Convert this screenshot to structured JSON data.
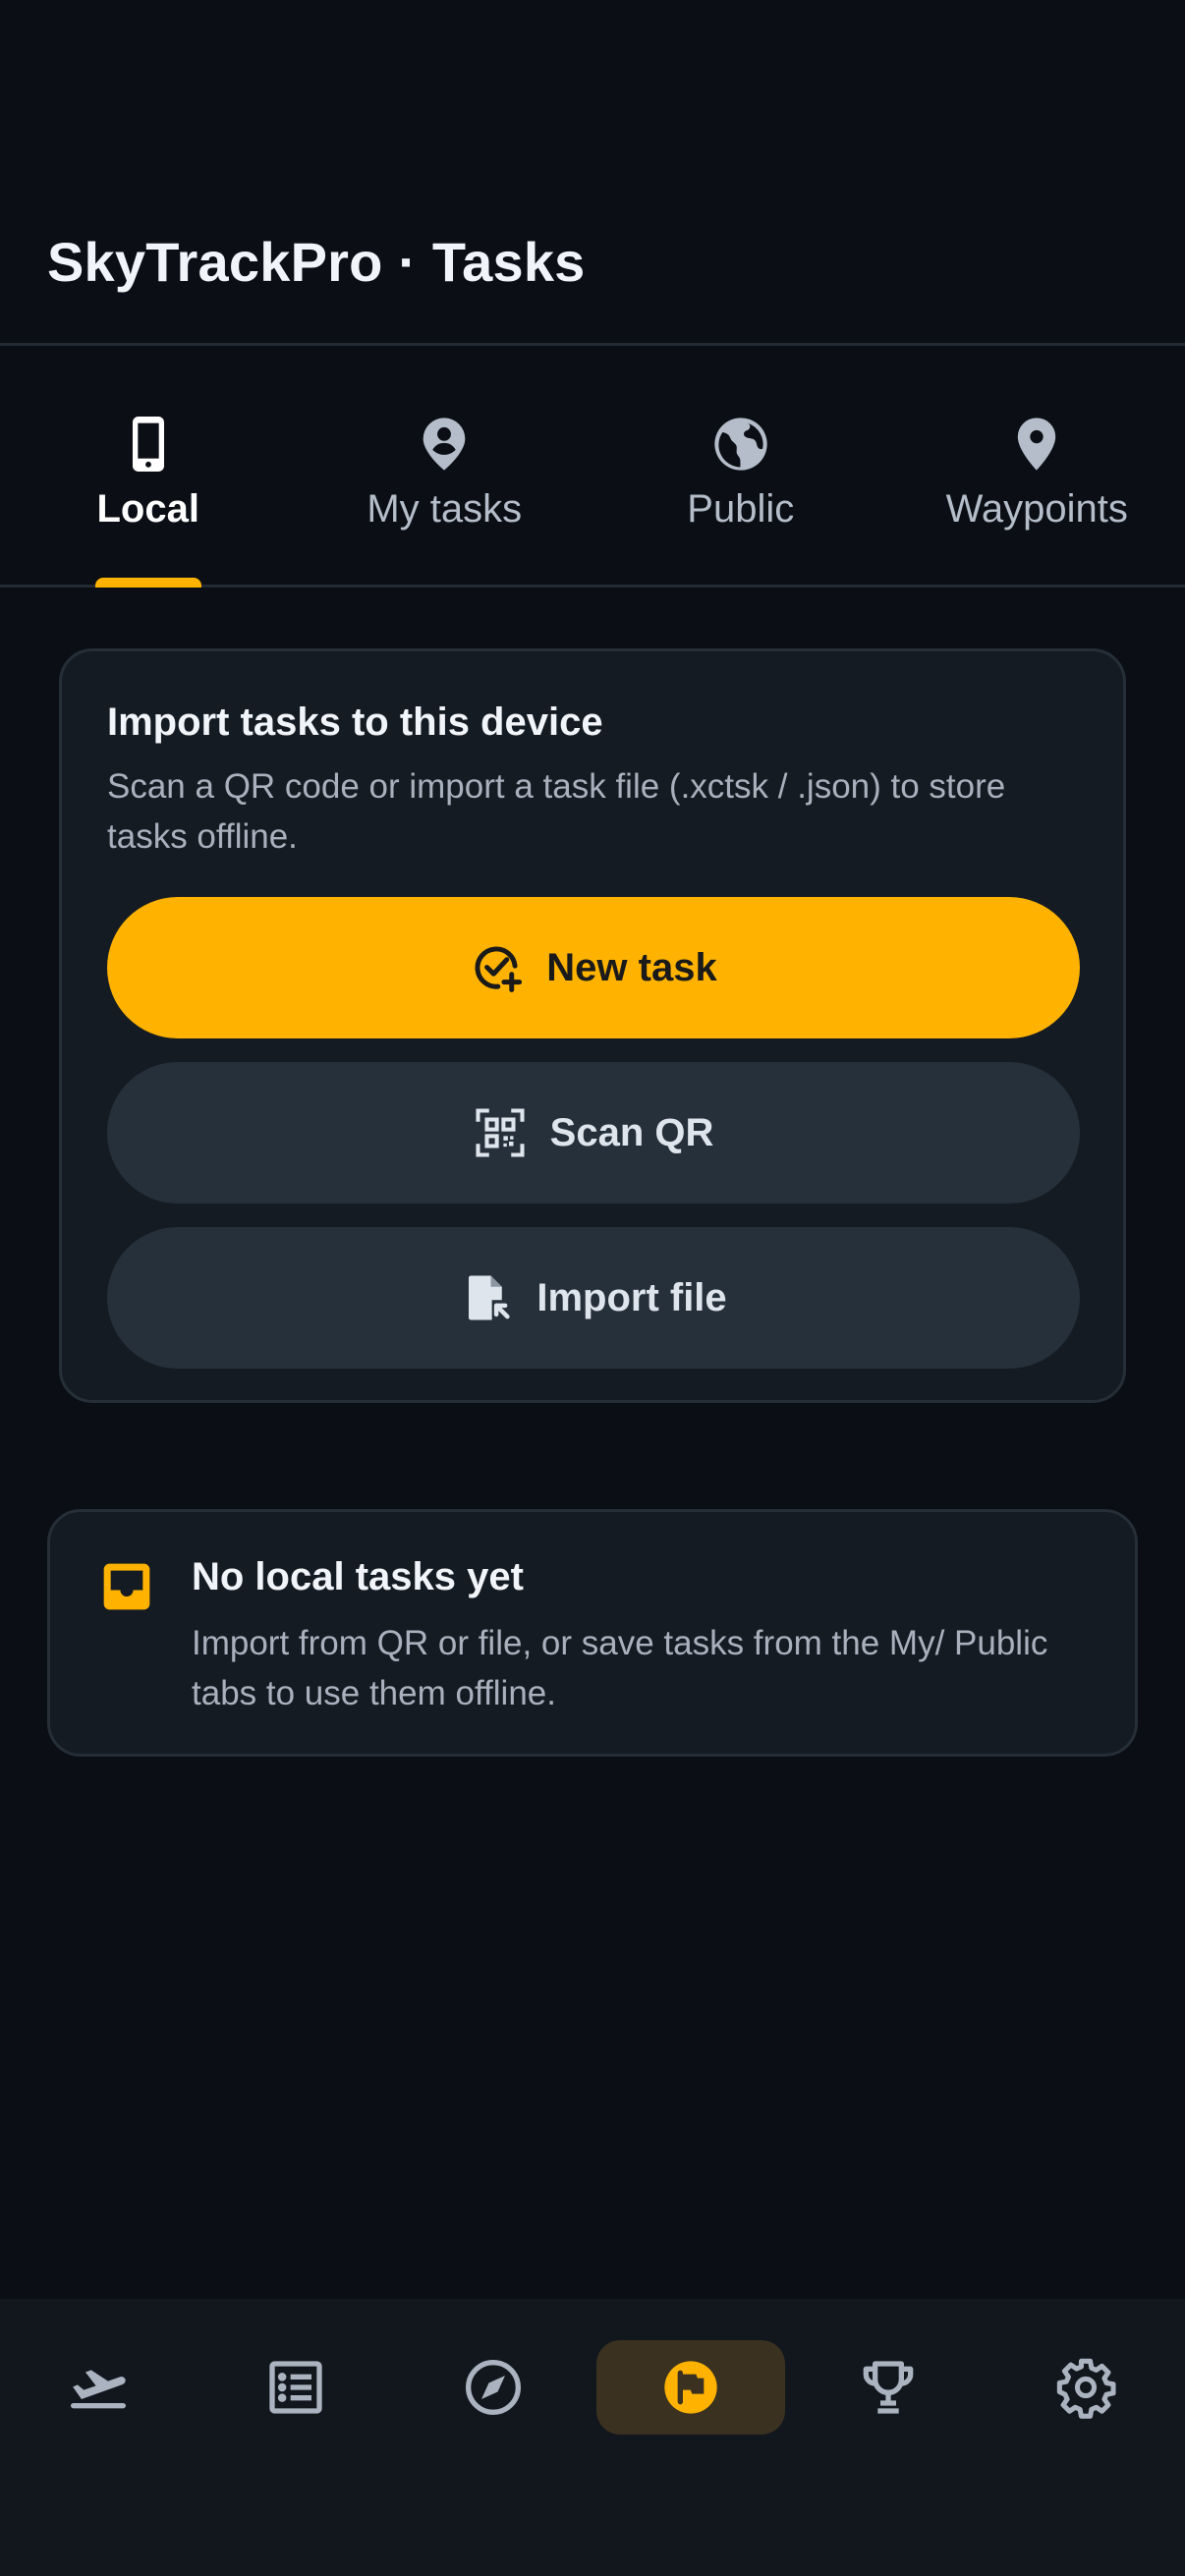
{
  "app": {
    "title": "SkyTrackPro · Tasks"
  },
  "tabs": [
    {
      "label": "Local",
      "icon": "phone-icon",
      "active": true
    },
    {
      "label": "My tasks",
      "icon": "account-pin-icon",
      "active": false
    },
    {
      "label": "Public",
      "icon": "globe-icon",
      "active": false
    },
    {
      "label": "Waypoints",
      "icon": "map-pin-icon",
      "active": false
    }
  ],
  "import_card": {
    "title": "Import tasks to this device",
    "description": "Scan a QR code or import a task file (.xctsk / .json) to store tasks offline.",
    "new_task_label": "New task",
    "scan_qr_label": "Scan QR",
    "import_file_label": "Import file"
  },
  "empty_state": {
    "title": "No local tasks yet",
    "description": "Import from QR or file, or save tasks from the My/ Public tabs to use them offline."
  },
  "bottom_nav": [
    {
      "icon": "takeoff-icon",
      "active": false
    },
    {
      "icon": "list-icon",
      "active": false
    },
    {
      "icon": "compass-icon",
      "active": false
    },
    {
      "icon": "flag-icon",
      "active": true
    },
    {
      "icon": "trophy-icon",
      "active": false
    },
    {
      "icon": "settings-icon",
      "active": false
    }
  ],
  "colors": {
    "accent": "#ffb300",
    "background": "#0b0e14",
    "card": "#151b22",
    "secondary_button": "#26303b"
  }
}
